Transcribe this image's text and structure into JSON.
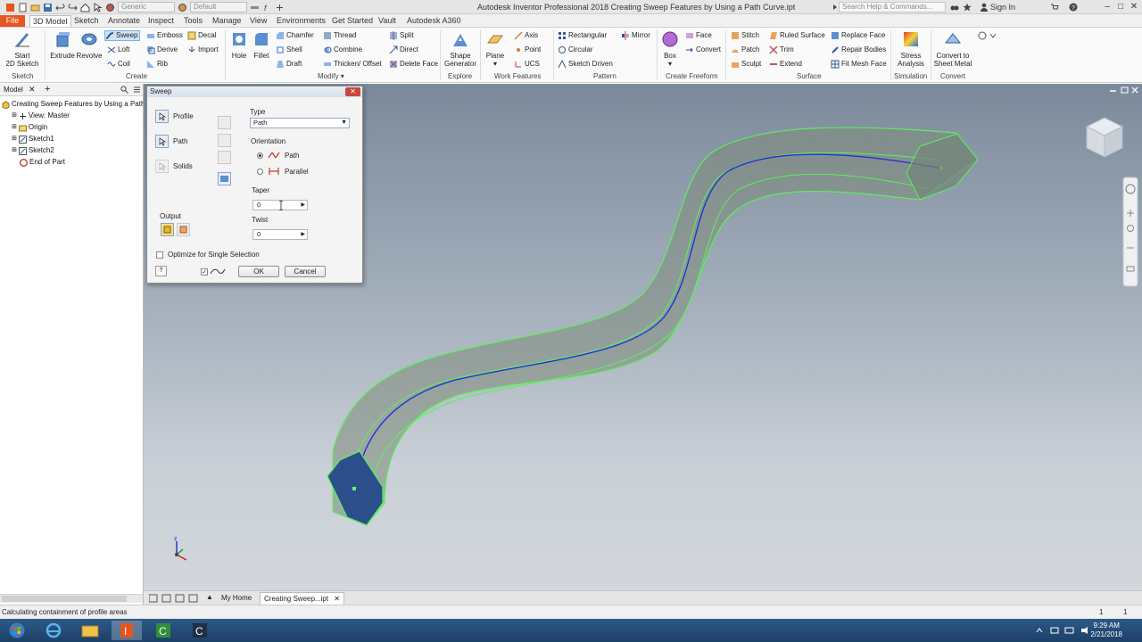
{
  "window": {
    "title": "Autodesk Inventor Professional 2018   Creating Sweep Features by Using a Path Curve.ipt",
    "appearance_combo": "Generic",
    "material_combo": "Default",
    "search_placeholder": "Search Help & Commands...",
    "sign_in": "Sign In"
  },
  "tabs": [
    {
      "label": "File"
    },
    {
      "label": "3D Model"
    },
    {
      "label": "Sketch"
    },
    {
      "label": "Annotate"
    },
    {
      "label": "Inspect"
    },
    {
      "label": "Tools"
    },
    {
      "label": "Manage"
    },
    {
      "label": "View"
    },
    {
      "label": "Environments"
    },
    {
      "label": "Get Started"
    },
    {
      "label": "Vault"
    },
    {
      "label": "Autodesk A360"
    }
  ],
  "ribbon": {
    "sketch": {
      "start": "Start",
      "sketch2d": "2D Sketch",
      "group": "Sketch"
    },
    "create": {
      "extrude": "Extrude",
      "revolve": "Revolve",
      "sweep": "Sweep",
      "loft": "Loft",
      "coil": "Coil",
      "emboss": "Emboss",
      "derive": "Derive",
      "rib": "Rib",
      "decal": "Decal",
      "import": "Import",
      "group": "Create"
    },
    "modify": {
      "hole": "Hole",
      "fillet": "Fillet",
      "chamfer": "Chamfer",
      "shell": "Shell",
      "draft": "Draft",
      "thread": "Thread",
      "combine": "Combine",
      "thicken": "Thicken/ Offset",
      "split": "Split",
      "direct": "Direct",
      "delete_face": "Delete Face",
      "group": "Modify"
    },
    "explore": {
      "shape1": "Shape",
      "shape2": "Generator",
      "group": "Explore"
    },
    "work": {
      "plane": "Plane",
      "axis": "Axis",
      "point": "Point",
      "ucs": "UCS",
      "group": "Work Features"
    },
    "pattern": {
      "rectangular": "Rectangular",
      "circular": "Circular",
      "sketch_driven": "Sketch Driven",
      "mirror": "Mirror",
      "group": "Pattern"
    },
    "freeform": {
      "box": "Box",
      "face": "Face",
      "convert": "Convert",
      "group": "Create Freeform"
    },
    "surface": {
      "stitch": "Stitch",
      "patch": "Patch",
      "sculpt": "Sculpt",
      "ruled": "Ruled Surface",
      "trim": "Trim",
      "extend": "Extend",
      "replace": "Replace Face",
      "repair": "Repair Bodies",
      "fit_mesh": "Fit Mesh Face",
      "group": "Surface"
    },
    "simulation": {
      "stress1": "Stress",
      "stress2": "Analysis",
      "group": "Simulation"
    },
    "convert": {
      "c1": "Convert to",
      "c2": "Sheet Metal",
      "group": "Convert"
    }
  },
  "browser": {
    "tab": "Model",
    "items": [
      {
        "label": "Creating Sweep Features by Using a Path Cu"
      },
      {
        "label": "View: Master"
      },
      {
        "label": "Origin"
      },
      {
        "label": "Sketch1"
      },
      {
        "label": "Sketch2"
      },
      {
        "label": "End of Part"
      }
    ]
  },
  "dialog": {
    "title": "Sweep",
    "profile": "Profile",
    "path": "Path",
    "solids": "Solids",
    "output": "Output",
    "type_label": "Type",
    "type_value": "Path",
    "orientation_label": "Orientation",
    "orient_path": "Path",
    "orient_parallel": "Parallel",
    "taper_label": "Taper",
    "taper_value": "0",
    "twist_label": "Twist",
    "twist_value": "0",
    "optimize": "Optimize for Single Selection",
    "ok": "OK",
    "cancel": "Cancel"
  },
  "doc_tabs": {
    "home": "My Home",
    "doc": "Creating Sweep...ipt"
  },
  "status": {
    "message": "Calculating containment of profile areas",
    "count1": "1",
    "count2": "1"
  },
  "taskbar": {
    "time": "9:29 AM",
    "date": "2/21/2018"
  },
  "colors": {
    "accent": "#e8541e",
    "path_curve": "#1a2fd6",
    "sweep_edge": "#5cf05c",
    "profile_face": "#2c4f8c"
  }
}
